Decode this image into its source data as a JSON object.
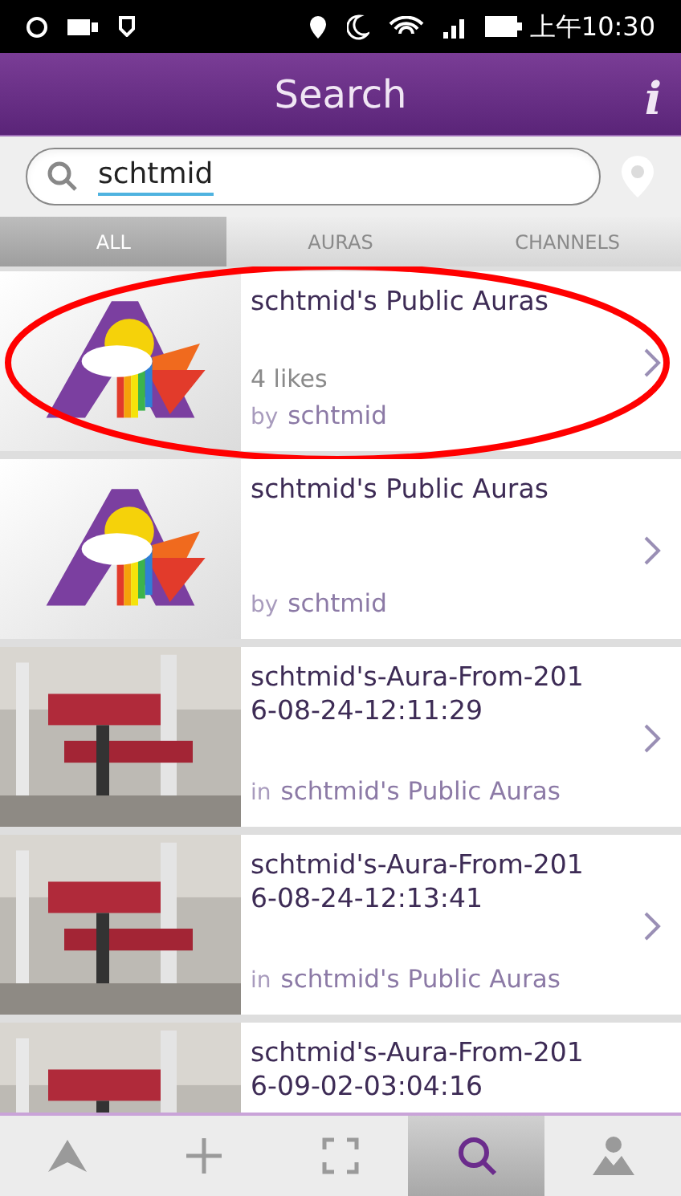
{
  "status_bar": {
    "time": "上午10:30"
  },
  "header": {
    "title": "Search",
    "info": "i"
  },
  "search": {
    "value": "schtmid"
  },
  "tabs": [
    {
      "label": "ALL",
      "selected": true
    },
    {
      "label": "AURAS",
      "selected": false
    },
    {
      "label": "CHANNELS",
      "selected": false
    }
  ],
  "results": [
    {
      "kind": "aura",
      "title_lines": [
        "schtmid's Public Auras"
      ],
      "likes": "4 likes",
      "meta": {
        "prefix": "by",
        "name": "schtmid"
      },
      "highlighted": true
    },
    {
      "kind": "aura",
      "title_lines": [
        "schtmid's Public Auras"
      ],
      "meta": {
        "prefix": "by",
        "name": "schtmid"
      },
      "highlighted": false
    },
    {
      "title_lines": [
        "schtmid's-Aura-From-201",
        "6-08-24-12:11:29"
      ],
      "meta": {
        "prefix": "in",
        "name": "schtmid's Public Auras"
      },
      "highlighted": false
    },
    {
      "title_lines": [
        "schtmid's-Aura-From-201",
        "6-08-24-12:13:41"
      ],
      "meta": {
        "prefix": "in",
        "name": "schtmid's Public Auras"
      },
      "highlighted": false
    },
    {
      "title_lines": [
        "schtmid's-Aura-From-201",
        "6-09-02-03:04:16"
      ],
      "highlighted": false
    }
  ],
  "bottom_nav": [
    {
      "kind": "aura",
      "selected": false
    },
    {
      "kind": "add",
      "selected": false
    },
    {
      "kind": "scan",
      "selected": false
    },
    {
      "kind": "search",
      "selected": true
    },
    {
      "kind": "profile",
      "selected": false
    }
  ]
}
